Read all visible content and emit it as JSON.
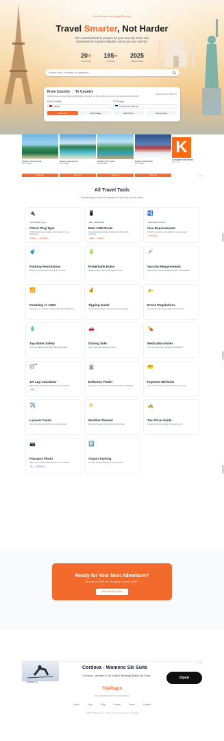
{
  "hero": {
    "tagline": "Free Forever • No Signup Required",
    "title_main": "Travel ",
    "title_accent": "Smarter",
    "title_end": ", Not Harder",
    "subtitle": "20+ essential tools to prepare for your next trip. From visa requirements to power adapters, we've got you covered.",
    "stats": [
      {
        "value": "20",
        "suffix": "+",
        "label": "Free Tools"
      },
      {
        "value": "195",
        "suffix": "+",
        "label": "Countries"
      },
      {
        "value": "2025",
        "suffix": "",
        "label": "Updated Data"
      }
    ],
    "search_placeholder": "Search tools, countries, or questions..."
  },
  "country_card": {
    "title": "From Country → To Country",
    "updated": "Data updated: 2025-10",
    "description": "Quickly access plugs/voltage/eSIM/tipping tools with one click. Remembers your last selection automatically.",
    "from_label": "From Country",
    "to_label": "To Country",
    "from_value": "Albania",
    "to_value": "Antigua and Barbuda",
    "actions": [
      "Check Visa",
      "Plug/Voltage",
      "eSIM Prices",
      "Tipping Guide"
    ]
  },
  "ads": {
    "hotels": [
      {
        "name": "Hotels in Punta Cana",
        "price": "from US$91",
        "cta": "Book now"
      },
      {
        "name": "Hotels in Santa Ana",
        "price": "from US$19",
        "cta": "Book now"
      },
      {
        "name": "Hotels in Pho Quoc",
        "price": "from US$25",
        "cta": "Book now"
      },
      {
        "name": "Hotels in Bucharest",
        "price": "from US$49",
        "cta": "Book now"
      }
    ],
    "kayak_letter": "K",
    "kayak_title": "Compare Hotel Prices",
    "kayak_sub": "kayak.com",
    "ad_choice": "▷ ✕"
  },
  "tools": {
    "title": "All Travel Tools",
    "subtitle": "Everything you need to prepare for your trip, in one place",
    "items": [
      {
        "icon": "plug-icon",
        "glyph": "🔌",
        "mini": "Check Plug Type",
        "name": "Check Plug Type",
        "desc": "Find the right power adapter and voltage for your destination",
        "tags": [
          "ADAPT",
          "POPULAR"
        ],
        "tag_colors": [
          "",
          ""
        ]
      },
      {
        "icon": "phone-icon",
        "glyph": "📱",
        "mini": "Best eSIM Deals",
        "name": "Best eSIM Deals",
        "desc": "Compare Airalo, Nomad, Holafly and other global providers",
        "tags": [
          "DATA",
          "SAVING"
        ],
        "tag_colors": [
          "",
          ""
        ]
      },
      {
        "icon": "passport-icon",
        "glyph": "🛂",
        "mini": "Visa Requirements",
        "name": "Visa Requirements",
        "desc": "Check if you need a visa based on your passport",
        "tags": [
          "ESSENTIAL"
        ],
        "tag_colors": [
          ""
        ]
      },
      {
        "icon": "luggage-icon",
        "glyph": "🧳",
        "mini": "",
        "name": "Packing Restrictions",
        "desc": "What you can and cannot bring on the plane",
        "tags": [],
        "tag_colors": []
      },
      {
        "icon": "battery-icon",
        "glyph": "🔋",
        "mini": "",
        "name": "Powerbank Rules",
        "desc": "Airline-specific power bank capacity limits",
        "tags": [],
        "tag_colors": []
      },
      {
        "icon": "syringe-icon",
        "glyph": "💉",
        "mini": "",
        "name": "Vaccine Requirements",
        "desc": "Required and recommended vaccines by destination",
        "tags": [],
        "tag_colors": []
      },
      {
        "icon": "roaming-icon",
        "glyph": "📶",
        "mini": "",
        "name": "Roaming vs eSIM",
        "desc": "Compare your carrier's roaming rates with eSIM prices",
        "tags": [],
        "tag_colors": []
      },
      {
        "icon": "money-bag-icon",
        "glyph": "💰",
        "mini": "",
        "name": "Tipping Guide",
        "desc": "Local tipping customs and expected percentages",
        "tags": [],
        "tag_colors": []
      },
      {
        "icon": "drone-icon",
        "glyph": "🚁",
        "mini": "",
        "name": "Drone Regulations",
        "desc": "Can you fly your drone legally in this country?",
        "tags": [],
        "tag_colors": []
      },
      {
        "icon": "water-drop-icon",
        "glyph": "💧",
        "mini": "",
        "name": "Tap Water Safety",
        "desc": "Is the tap water safe to drink? Best water filters",
        "tags": [],
        "tag_colors": []
      },
      {
        "icon": "car-icon",
        "glyph": "🚗",
        "mini": "",
        "name": "Driving Side",
        "desc": "Left or right side driving by country",
        "tags": [],
        "tag_colors": []
      },
      {
        "icon": "pill-icon",
        "glyph": "💊",
        "mini": "",
        "name": "Medication Rules",
        "desc": "Can you bring your prescription medication?",
        "tags": [],
        "tag_colors": []
      },
      {
        "icon": "sleepy-face-icon",
        "glyph": "😴",
        "mini": "",
        "name": "Jet Lag Calculator",
        "desc": "Beat jet lag with science-backed sleep schedules",
        "tags": [
          "NEW"
        ],
        "tag_colors": [
          "green"
        ]
      },
      {
        "icon": "embassy-icon",
        "glyph": "🏛️",
        "mini": "",
        "name": "Embassy Finder",
        "desc": "Emergency contacts and embassy locations worldwide",
        "tags": [],
        "tag_colors": []
      },
      {
        "icon": "credit-card-icon",
        "glyph": "💳",
        "mini": "",
        "name": "Payment Methods",
        "desc": "Cash or card? Best payment options by country",
        "tags": [],
        "tag_colors": []
      },
      {
        "icon": "airplane-icon",
        "glyph": "✈️",
        "mini": "",
        "name": "Layover Guide",
        "desc": "Can you leave the airport during your layover?",
        "tags": [],
        "tag_colors": []
      },
      {
        "icon": "weather-icon",
        "glyph": "🌤️",
        "mini": "",
        "name": "Weather Planner",
        "desc": "Best travel season & historical weather data",
        "tags": [],
        "tag_colors": []
      },
      {
        "icon": "taxi-icon",
        "glyph": "🚕",
        "mini": "",
        "name": "Taxi Price Guide",
        "desc": "Typical taxi fares and best ride apps by city",
        "tags": [],
        "tag_colors": []
      },
      {
        "icon": "camera-icon",
        "glyph": "📷",
        "mini": "",
        "name": "Passport Photo",
        "desc": "Generate compliant passport photos from selfies",
        "tags": [
          "AI",
          "TRENDING"
        ],
        "tag_colors": [
          "blue",
          "purple"
        ]
      },
      {
        "icon": "parking-icon",
        "glyph": "🅿️",
        "mini": "",
        "name": "Airport Parking",
        "desc": "Find the cheapest parking at major airports",
        "tags": [],
        "tag_colors": []
      }
    ]
  },
  "cta": {
    "title": "Ready for Your Next Adventure?",
    "subtitle": "All tools are 100% free. No signup, no spam, no BS.",
    "button": "Start with Plug Check"
  },
  "bottom_ad": {
    "title": "Cordova - Womens Ski Suits",
    "subtitle": "Cordova - Women's Ski Suits & Ethically Made Ski Gear.",
    "brand": "Cordova Co",
    "button": "Open",
    "ad_choice": "▷ ✕"
  },
  "footer": {
    "logo": "TripPlugin",
    "tagline": "Essential travel tools for smart travelers",
    "links": [
      "About",
      "Tools",
      "Blog",
      "Privacy",
      "Terms",
      "Contact"
    ],
    "copyright": "© 2025 TripPlugin.com · Made with care for travelers worldwide"
  },
  "colors": {
    "accent": "#f26b2d",
    "kayak": "#ff690f"
  }
}
